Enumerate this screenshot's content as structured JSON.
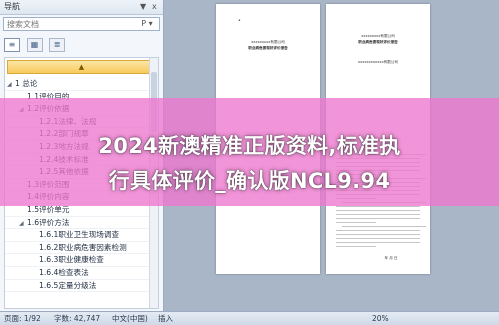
{
  "nav_pane": {
    "title": "导航",
    "controls": [
      "▼",
      "x"
    ],
    "search_placeholder": "搜索文档",
    "search_button": "P ▾",
    "view_tabs": [
      "≡",
      "▦",
      "≣"
    ],
    "collapse_label": "▲"
  },
  "tree_items": [
    {
      "label": "1 总论",
      "level": 1,
      "twisty": "◢"
    },
    {
      "label": "1.1评价目的",
      "level": 2,
      "twisty": ""
    },
    {
      "label": "1.2评价依据",
      "level": 2,
      "twisty": "◢"
    },
    {
      "label": "1.2.1法律、法规",
      "level": 3,
      "twisty": ""
    },
    {
      "label": "1.2.2部门规章",
      "level": 3,
      "twisty": ""
    },
    {
      "label": "1.2.3地方法规",
      "level": 3,
      "twisty": ""
    },
    {
      "label": "1.2.4技术标准",
      "level": 3,
      "twisty": ""
    },
    {
      "label": "1.2.5其他依据",
      "level": 3,
      "twisty": ""
    },
    {
      "label": "1.3评价范围",
      "level": 2,
      "twisty": ""
    },
    {
      "label": "1.4评价内容",
      "level": 2,
      "twisty": ""
    },
    {
      "label": "1.5评价单元",
      "level": 2,
      "twisty": ""
    },
    {
      "label": "1.6评价方法",
      "level": 2,
      "twisty": "◢"
    },
    {
      "label": "1.6.1职业卫生现场调查",
      "level": 3,
      "twisty": ""
    },
    {
      "label": "1.6.2职业病危害因素检测",
      "level": 3,
      "twisty": ""
    },
    {
      "label": "1.6.3职业健康检查",
      "level": 3,
      "twisty": ""
    },
    {
      "label": "1.6.4检查表法",
      "level": 3,
      "twisty": ""
    },
    {
      "label": "1.6.5定量分级法",
      "level": 3,
      "twisty": ""
    }
  ],
  "pages": {
    "page1_header": "xxxxxxxxx有限公司",
    "page1_title": "职业病危害现状评价报告",
    "page2_header": "xxxxxxxxx有限公司",
    "page2_title": "职业病危害现状评价报告",
    "page2_sub": "xxxxxxxxxxxx有限公司",
    "page2_footer": "年 月 日"
  },
  "status_bar": {
    "page": "页面: 1/92",
    "words": "字数: 42,747",
    "lang": "中文(中国)",
    "mode": "插入",
    "zoom": "20%"
  },
  "overlay": {
    "line1": "2024新澳精准正版资料,标准执",
    "line2": "行具体评价_确认版NCL9.94"
  }
}
